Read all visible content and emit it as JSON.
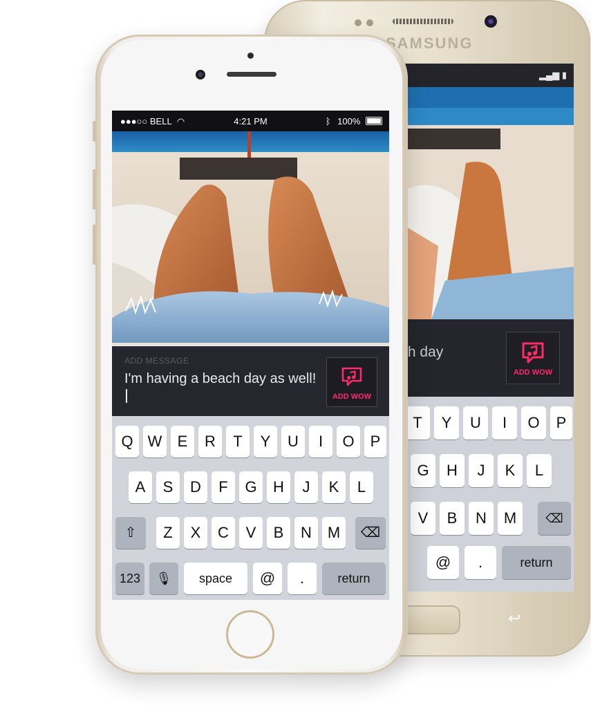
{
  "samsung": {
    "brand": "SAMSUNG",
    "message_text": "th day",
    "wow_label": "ADD WOW",
    "keys_row1": [
      "T",
      "Y",
      "U",
      "I",
      "O",
      "P"
    ],
    "keys_row2": [
      "G",
      "H",
      "J",
      "K",
      "L"
    ],
    "keys_row3": [
      "V",
      "B",
      "N",
      "M"
    ],
    "keys_row4": [
      "@",
      ".",
      "return"
    ]
  },
  "status_bar": {
    "carrier": "●●●○○ BELL",
    "time": "4:21 PM",
    "battery": "100%"
  },
  "composer": {
    "label": "ADD MESSAGE",
    "text": "I'm having a beach day as well!",
    "wow_button_label": "ADD WOW"
  },
  "keyboard": {
    "row1": [
      "Q",
      "W",
      "E",
      "R",
      "T",
      "Y",
      "U",
      "I",
      "O",
      "P"
    ],
    "row2": [
      "A",
      "S",
      "D",
      "F",
      "G",
      "H",
      "J",
      "K",
      "L"
    ],
    "row3": [
      "Z",
      "X",
      "C",
      "V",
      "B",
      "N",
      "M"
    ],
    "numbers_label": "123",
    "space_label": "space",
    "at_label": "@",
    "dot_label": ".",
    "return_label": "return"
  },
  "colors": {
    "accent": "#ff2a6a",
    "panel": "#26262e",
    "keyboard_bg": "#d1d5db"
  }
}
